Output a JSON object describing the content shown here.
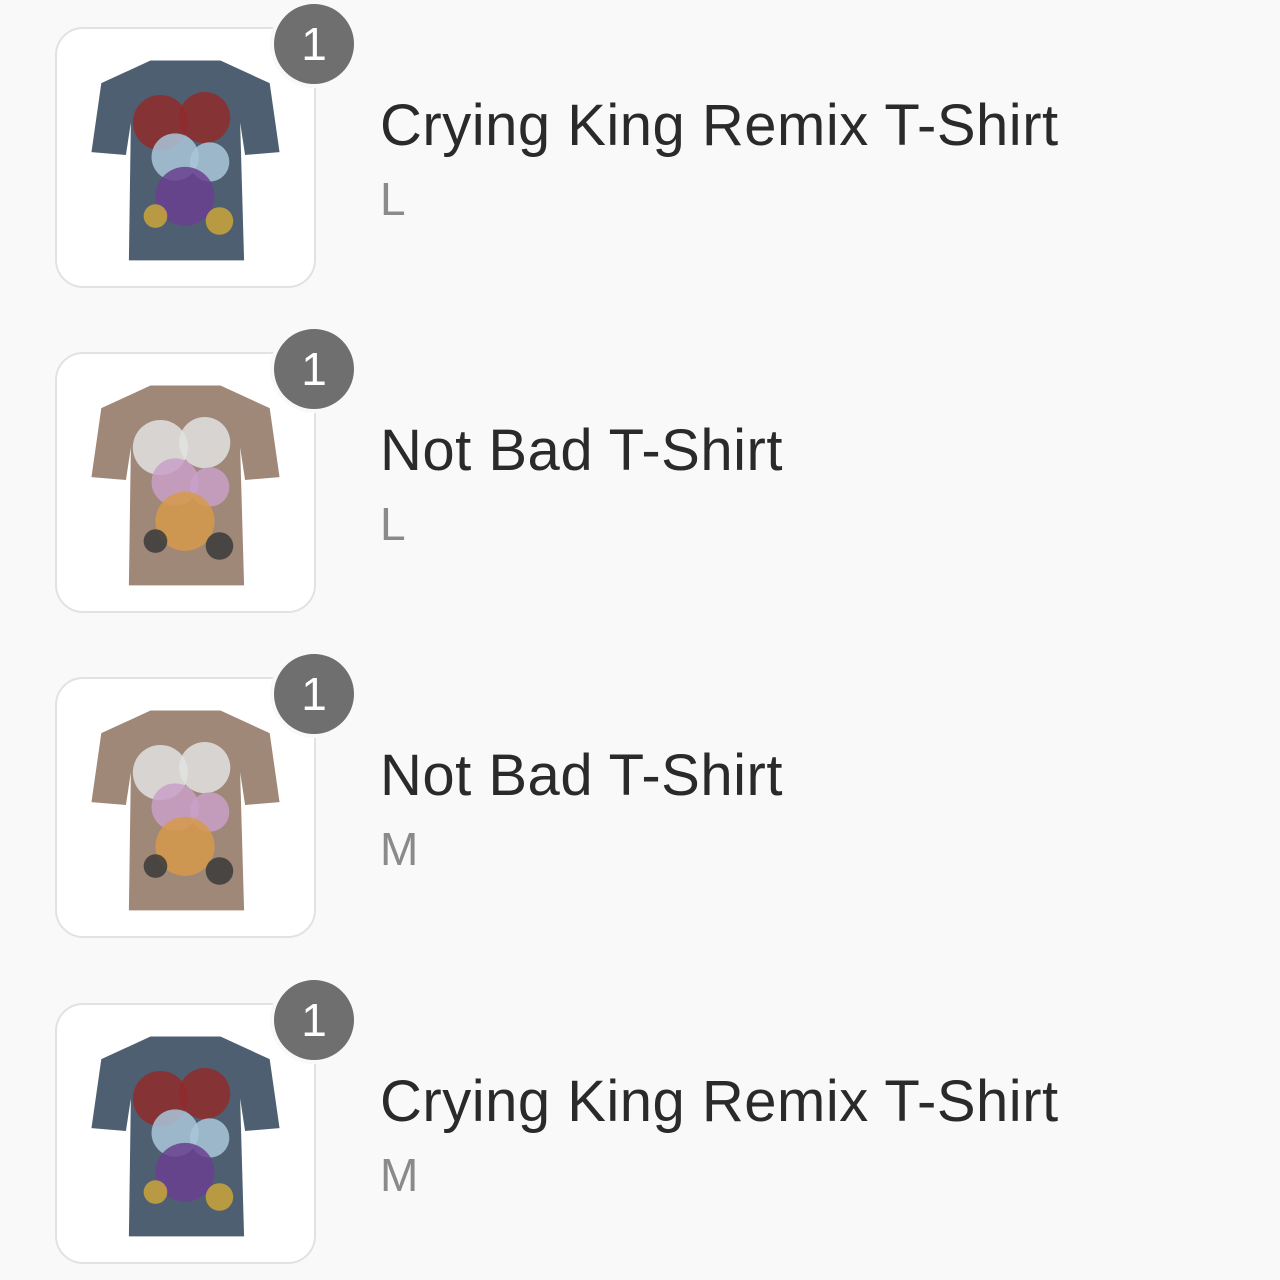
{
  "cart": {
    "items": [
      {
        "quantity": "1",
        "title": "Crying King Remix T-Shirt",
        "variant": "L",
        "image_icon": "crying-king-tshirt-image",
        "shirt_color": "#4f5f72",
        "print_colors": [
          "#8f2b2b",
          "#a9c6d9",
          "#6a3f8f",
          "#c9a43a"
        ]
      },
      {
        "quantity": "1",
        "title": "Not Bad T-Shirt",
        "variant": "L",
        "image_icon": "not-bad-tshirt-image",
        "shirt_color": "#a08878",
        "print_colors": [
          "#e2e2e2",
          "#c9a0c8",
          "#d69a4a",
          "#3a3a3a"
        ]
      },
      {
        "quantity": "1",
        "title": "Not Bad T-Shirt",
        "variant": "M",
        "image_icon": "not-bad-tshirt-image",
        "shirt_color": "#a08878",
        "print_colors": [
          "#e2e2e2",
          "#c9a0c8",
          "#d69a4a",
          "#3a3a3a"
        ]
      },
      {
        "quantity": "1",
        "title": "Crying King Remix T-Shirt",
        "variant": "M",
        "image_icon": "crying-king-tshirt-image",
        "shirt_color": "#4f5f72",
        "print_colors": [
          "#8f2b2b",
          "#a9c6d9",
          "#6a3f8f",
          "#c9a43a"
        ]
      }
    ]
  }
}
